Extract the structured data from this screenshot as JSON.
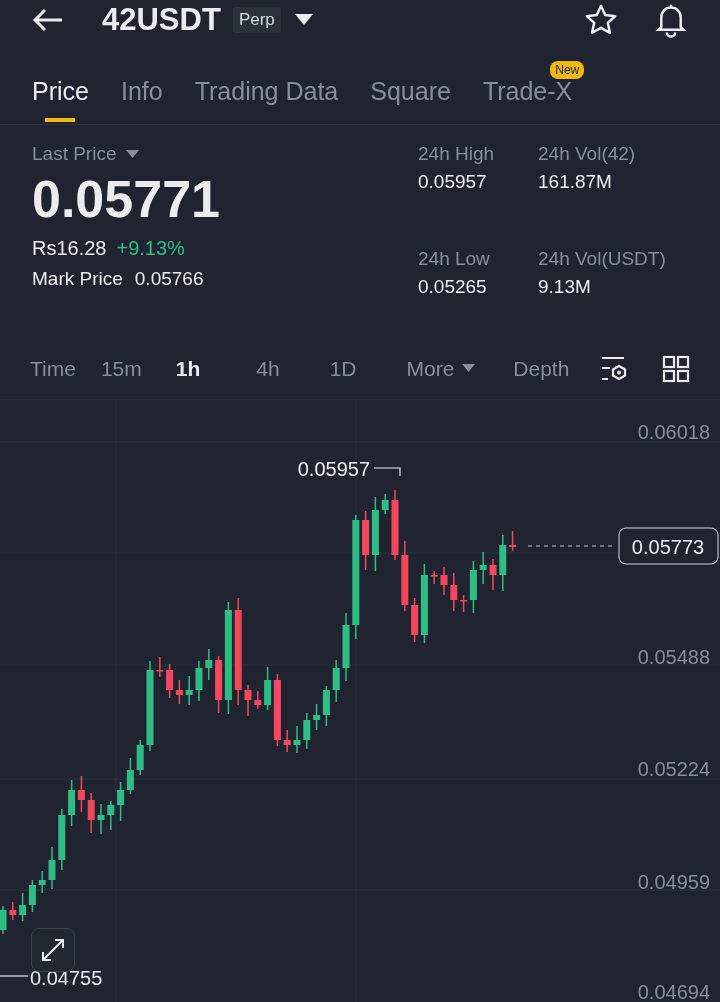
{
  "header": {
    "symbol": "42USDT",
    "badge": "Perp"
  },
  "tabs": [
    {
      "label": "Price",
      "selected": true
    },
    {
      "label": "Info",
      "selected": false
    },
    {
      "label": "Trading Data",
      "selected": false
    },
    {
      "label": "Square",
      "selected": false
    },
    {
      "label": "Trade-X",
      "selected": false,
      "badge": "New"
    }
  ],
  "summary": {
    "last_price_label": "Last Price",
    "price": "0.05771",
    "fiat": "Rs16.28",
    "change": "+9.13%",
    "mark_label": "Mark Price",
    "mark_value": "0.05766"
  },
  "stats": [
    {
      "label": "24h High",
      "value": "0.05957"
    },
    {
      "label": "24h Vol(42)",
      "value": "161.87M"
    },
    {
      "label": "24h Low",
      "value": "0.05265"
    },
    {
      "label": "24h Vol(USDT)",
      "value": "9.13M"
    }
  ],
  "intervals": [
    {
      "label": "Time",
      "selected": false,
      "kind": "plain"
    },
    {
      "label": "15m",
      "selected": false,
      "kind": "plain"
    },
    {
      "label": "1h",
      "selected": true,
      "kind": "plain"
    },
    {
      "label": "4h",
      "selected": false,
      "kind": "plain"
    },
    {
      "label": "1D",
      "selected": false,
      "kind": "plain"
    },
    {
      "label": "More",
      "selected": false,
      "kind": "dropdown"
    },
    {
      "label": "Depth",
      "selected": false,
      "kind": "plain"
    }
  ],
  "chart": {
    "price_ticks": [
      "0.06018",
      "0.05488",
      "0.05224",
      "0.04959",
      "0.04694"
    ],
    "high_marker": "0.05957",
    "low_marker": "0.04755",
    "current_price": "0.05773"
  }
}
